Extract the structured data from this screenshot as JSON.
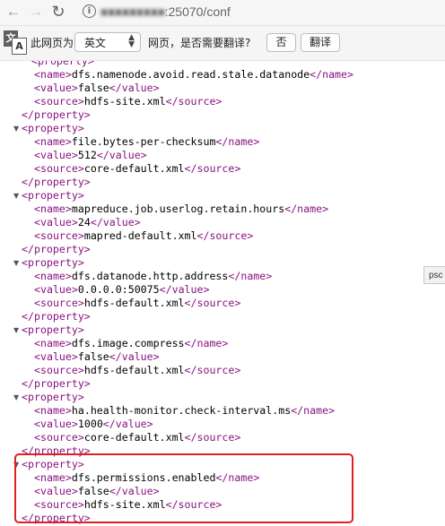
{
  "toolbar": {
    "back_glyph": "←",
    "forward_glyph": "→",
    "reload_glyph": "↻",
    "info_glyph": "i",
    "url_host": "■■■■■■■■■",
    "url_port_path": ":25070/conf"
  },
  "translate_bar": {
    "icon_a": "文",
    "icon_b": "A",
    "page_is": "此网页为",
    "language": "英文",
    "page_suffix": "网页，是否需要翻译?",
    "no_label": "否",
    "translate_label": "翻译"
  },
  "tooltip": {
    "text": "psc"
  },
  "highlight_color": "#e02020",
  "xml": {
    "partial_top": "<property>",
    "properties": [
      {
        "name": "dfs.namenode.avoid.read.stale.datanode",
        "value": "false",
        "source": "hdfs-site.xml"
      },
      {
        "name": "file.bytes-per-checksum",
        "value": "512",
        "source": "core-default.xml"
      },
      {
        "name": "mapreduce.job.userlog.retain.hours",
        "value": "24",
        "source": "mapred-default.xml"
      },
      {
        "name": "dfs.datanode.http.address",
        "value": "0.0.0.0:50075",
        "source": "hdfs-default.xml"
      },
      {
        "name": "dfs.image.compress",
        "value": "false",
        "source": "hdfs-default.xml"
      },
      {
        "name": "ha.health-monitor.check-interval.ms",
        "value": "1000",
        "source": "core-default.xml"
      },
      {
        "name": "dfs.permissions.enabled",
        "value": "false",
        "source": "hdfs-site.xml"
      }
    ]
  }
}
